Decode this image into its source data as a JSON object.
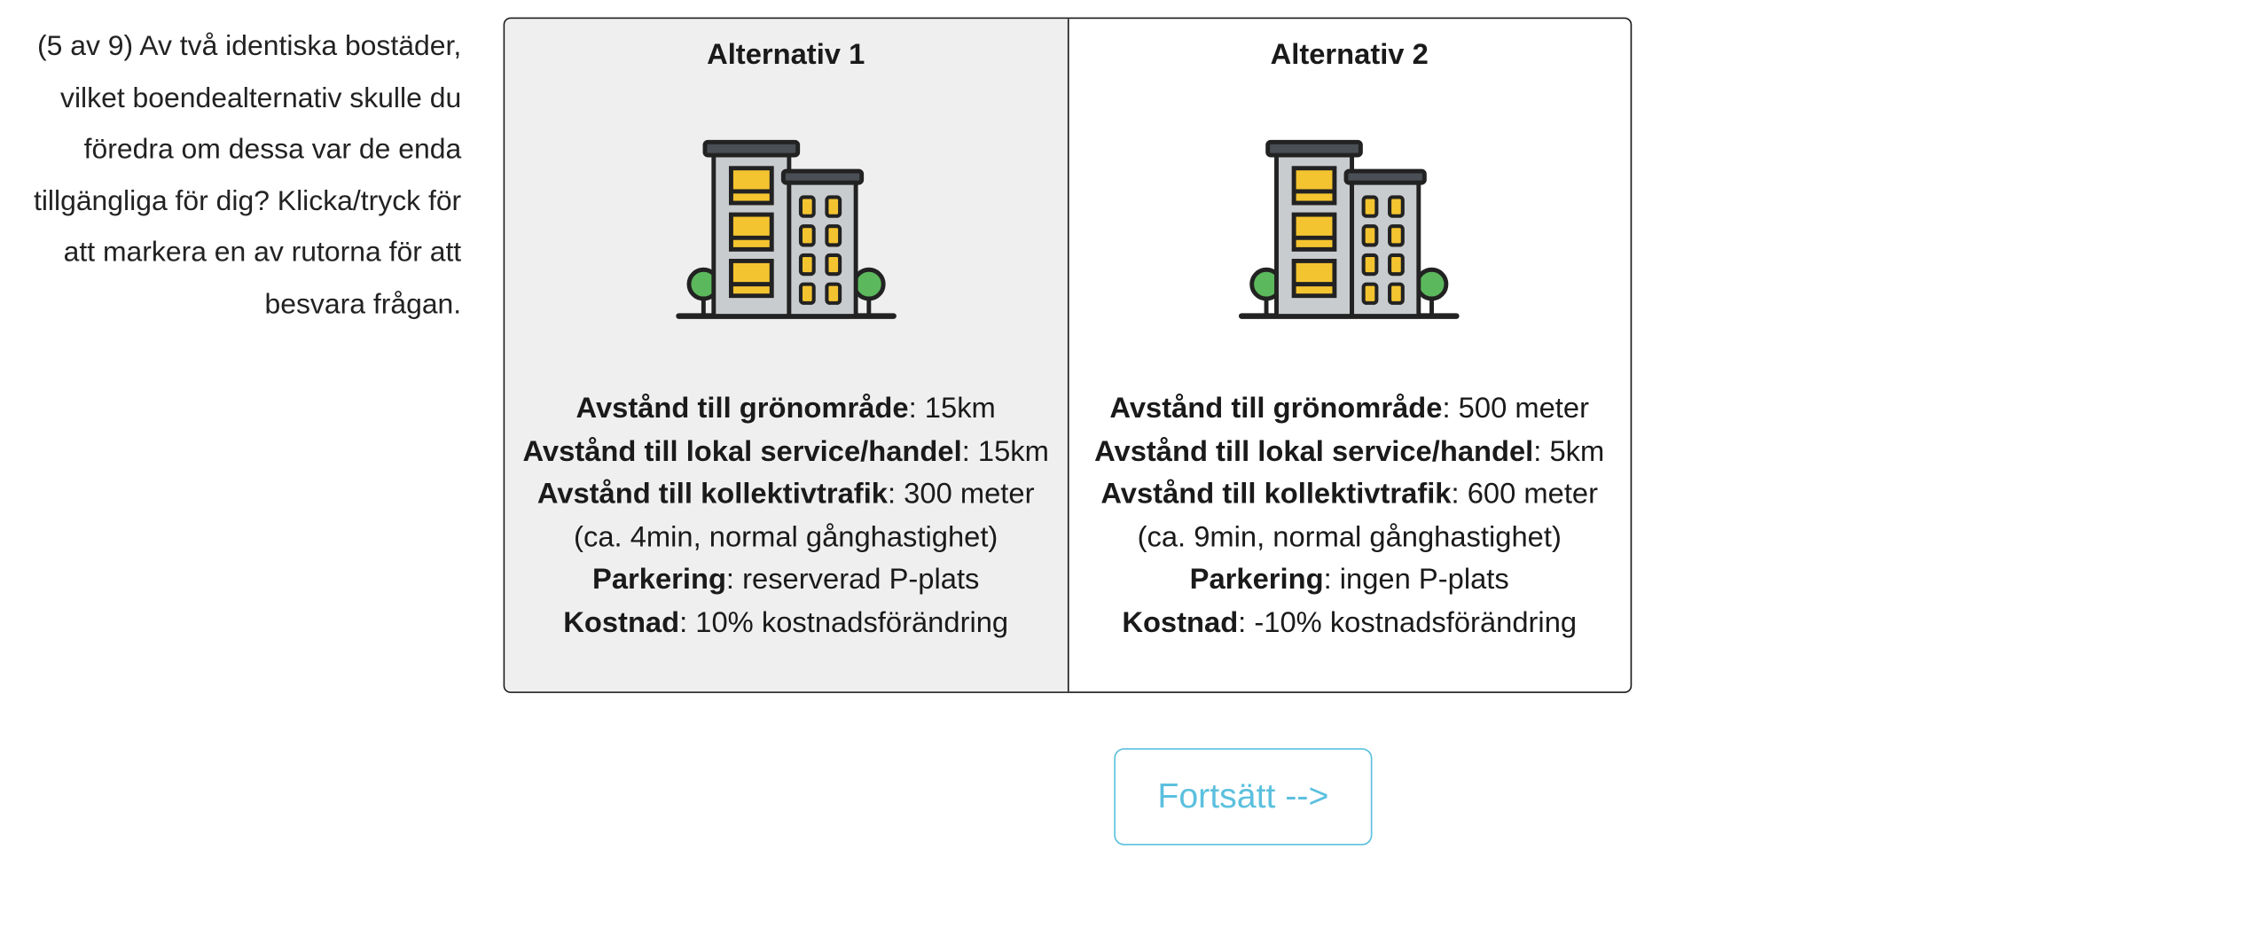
{
  "question": {
    "text": "(5 av 9) Av två identiska bostäder, vilket boendealternativ skulle du föredra om dessa var de enda tillgängliga för dig? Klicka/tryck för att markera en av rutorna för att besvara frågan."
  },
  "alternatives": [
    {
      "title": "Alternativ 1",
      "icon": "apartment-building-icon",
      "selected": true,
      "attributes": [
        {
          "label": "Avstånd till grönområde",
          "value": ": 15km"
        },
        {
          "label": "Avstånd till lokal service/handel",
          "value": ": 15km"
        },
        {
          "label": "Avstånd till kollektivtrafik",
          "value": ": 300 meter"
        },
        {
          "label": "",
          "value": "(ca. 4min, normal gånghastighet)"
        },
        {
          "label": "Parkering",
          "value": ": reserverad P-plats"
        },
        {
          "label": "Kostnad",
          "value": ": 10% kostnadsförändring"
        }
      ]
    },
    {
      "title": "Alternativ 2",
      "icon": "apartment-building-icon",
      "selected": false,
      "attributes": [
        {
          "label": "Avstånd till grönområde",
          "value": ": 500 meter"
        },
        {
          "label": "Avstånd till lokal service/handel",
          "value": ": 5km"
        },
        {
          "label": "Avstånd till kollektivtrafik",
          "value": ": 600 meter"
        },
        {
          "label": "",
          "value": "(ca. 9min, normal gånghastighet)"
        },
        {
          "label": "Parkering",
          "value": ": ingen P-plats"
        },
        {
          "label": "Kostnad",
          "value": ": -10% kostnadsförändring"
        }
      ]
    }
  ],
  "continue_button": {
    "label": "Fortsätt -->"
  },
  "colors": {
    "accent": "#5bc0de",
    "selected_background": "#efefef",
    "building_body": "#c9cccf",
    "window_light": "#f4c430",
    "tree": "#5cb85c"
  }
}
